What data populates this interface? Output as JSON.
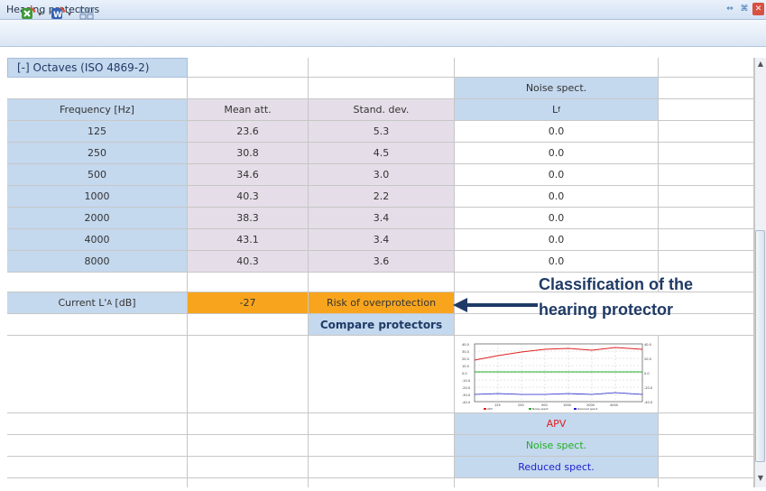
{
  "window": {
    "title": "Hearing protectors"
  },
  "section": {
    "label": "[-] Octaves (ISO 4869-2)"
  },
  "noise_spect_header": "Noise spect.",
  "columns": {
    "frequency": "Frequency [Hz]",
    "mean_att": "Mean att.",
    "stand_dev": "Stand. dev.",
    "lf": "Lf"
  },
  "rows": [
    {
      "freq": "125",
      "mean": "23.6",
      "sd": "5.3",
      "lf": "0.0"
    },
    {
      "freq": "250",
      "mean": "30.8",
      "sd": "4.5",
      "lf": "0.0"
    },
    {
      "freq": "500",
      "mean": "34.6",
      "sd": "3.0",
      "lf": "0.0"
    },
    {
      "freq": "1000",
      "mean": "40.3",
      "sd": "2.2",
      "lf": "0.0"
    },
    {
      "freq": "2000",
      "mean": "38.3",
      "sd": "3.4",
      "lf": "0.0"
    },
    {
      "freq": "4000",
      "mean": "43.1",
      "sd": "3.4",
      "lf": "0.0"
    },
    {
      "freq": "8000",
      "mean": "40.3",
      "sd": "3.6",
      "lf": "0.0"
    }
  ],
  "current_la": {
    "label": "Current L'A [dB]",
    "value": "-27",
    "status": "Risk of overprotection"
  },
  "compare_button": "Compare protectors",
  "annotation": {
    "line1": "Classification of the",
    "line2": "hearing protector"
  },
  "legend_rows": [
    "APV",
    "Noise spect.",
    "Reduced spect."
  ],
  "colors": {
    "apv": "#e02020",
    "noise": "#22b022",
    "reduced": "#2020d0",
    "orange": "#f8a51d",
    "cell_blue": "#c4d8ee",
    "cell_lavender": "#e5dde7"
  },
  "icons": [
    "excel-export-icon",
    "word-export-icon",
    "layout-icon",
    "restore-icon",
    "maximize-icon",
    "close-icon"
  ]
}
